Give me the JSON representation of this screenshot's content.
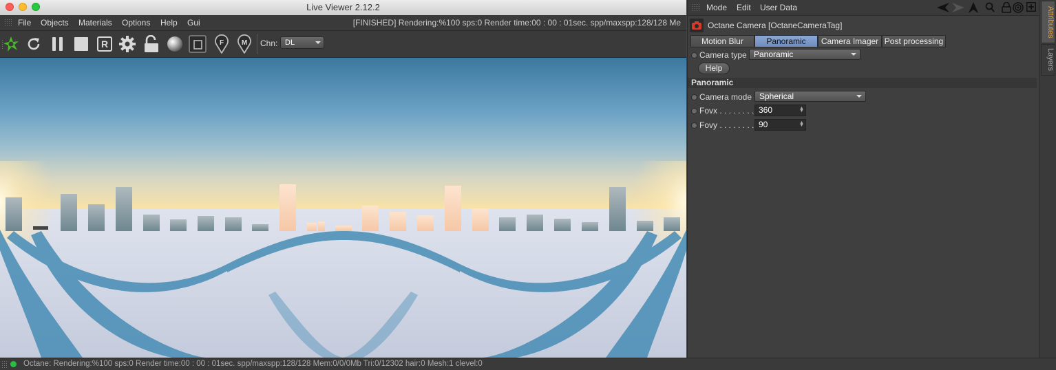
{
  "live_viewer": {
    "title": "Live Viewer 2.12.2",
    "menu": [
      "File",
      "Objects",
      "Materials",
      "Options",
      "Help",
      "Gui"
    ],
    "status_text": "[FINISHED]  Rendering:%100 sps:0 Render time:00 : 00 : 01sec. spp/maxspp:128/128 Me",
    "toolbar_icons": [
      "octane-logo-icon",
      "refresh-icon",
      "pause-icon",
      "stop-icon",
      "region-render-icon",
      "settings-gear-icon",
      "lock-icon",
      "material-sphere-icon",
      "clay-mode-icon",
      "focus-pick-icon",
      "material-pick-icon"
    ],
    "region_letter": "R",
    "focus_letter": "F",
    "material_letter": "M",
    "channel_label": "Chn:",
    "channel_value": "DL"
  },
  "statusbar": {
    "text": "Octane: Rendering:%100 sps:0 Render time:00 : 00 : 01sec. spp/maxspp:128/128 Mem:0/0/0Mb Tri:0/12302 hair:0 Mesh:1 clevel:0"
  },
  "attributes": {
    "menu": [
      "Mode",
      "Edit",
      "User Data"
    ],
    "object_title": "Octane Camera [OctaneCameraTag]",
    "tabs": [
      {
        "label": "Motion Blur",
        "active": false
      },
      {
        "label": "Panoramic",
        "active": true
      },
      {
        "label": "Camera Imager",
        "active": false
      },
      {
        "label": "Post processing",
        "active": false
      }
    ],
    "camera_type_label": "Camera type",
    "camera_type_value": "Panoramic",
    "help_label": "Help",
    "section_title": "Panoramic",
    "camera_mode_label": "Camera mode",
    "camera_mode_value": "Spherical",
    "fovx_label": "Fovx . . . . . . . .",
    "fovx_value": "360",
    "fovy_label": "Fovy . . . . . . . .",
    "fovy_value": "90"
  },
  "side_tabs": [
    "Attributes",
    "Layers"
  ],
  "colors": {
    "active_tab": "#7b97c9",
    "attributes_tab_text": "#e8a33a",
    "sky_top": "#3e7aa3",
    "horizon": "#f7e2aa",
    "ground": "#c9d3e1",
    "status_dot": "#28c040"
  }
}
